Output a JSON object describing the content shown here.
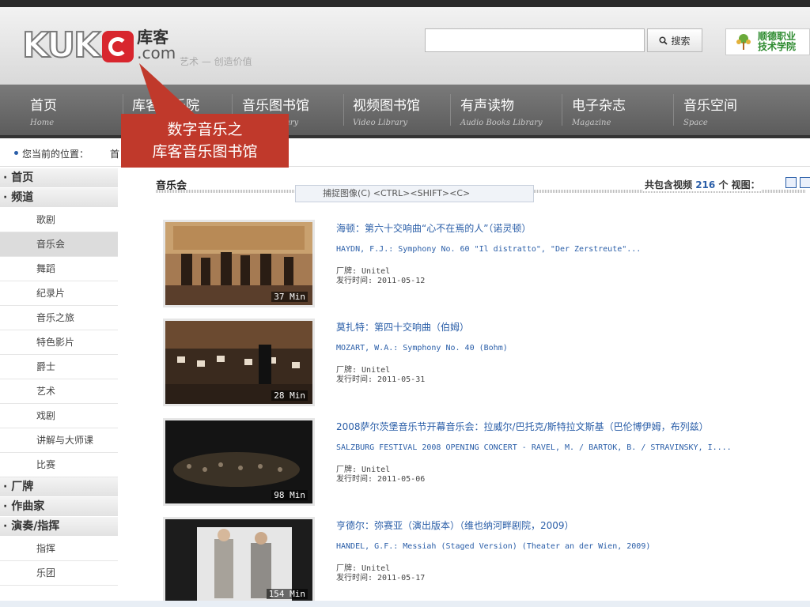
{
  "header": {
    "logo_main": "KUK",
    "logo_cn": "库客",
    "logo_com": ".com",
    "slogan": "艺术 — 创造价值",
    "search_placeholder": "",
    "search_button": "搜索",
    "school_line1": "顺德职业",
    "school_line2": "技术学院"
  },
  "nav": [
    {
      "cn": "首页",
      "en": "Home"
    },
    {
      "cn": "库客音乐院",
      "en": ""
    },
    {
      "cn": "音乐图书馆",
      "en": "Music Library"
    },
    {
      "cn": "视频图书馆",
      "en": "Video Library"
    },
    {
      "cn": "有声读物",
      "en": "Audio Books Library"
    },
    {
      "cn": "电子杂志",
      "en": "Magazine"
    },
    {
      "cn": "音乐空间",
      "en": "Space"
    }
  ],
  "breadcrumb": {
    "label": "您当前的位置：",
    "home": "首"
  },
  "callout": {
    "line1": "数字音乐之",
    "line2": "库客音乐图书馆"
  },
  "sidebar": {
    "home": "· 首页",
    "channel": "· 频道",
    "channel_items": [
      "歌剧",
      "音乐会",
      "舞蹈",
      "纪录片",
      "音乐之旅",
      "特色影片",
      "爵士",
      "艺术",
      "戏剧",
      "讲解与大师课",
      "比赛"
    ],
    "active_item": "音乐会",
    "label_heading": "· 厂牌",
    "composer_heading": "· 作曲家",
    "performer_heading": "· 演奏/指挥",
    "performer_items": [
      "指挥",
      "乐团"
    ]
  },
  "content": {
    "title": "音乐会",
    "capture_tip": "捕捉图像(C)   <CTRL><SHIFT><C>",
    "total_prefix": "共包含视频",
    "total_count": "216",
    "total_suffix": "个  视图：",
    "videos": [
      {
        "title": "海顿：第六十交响曲“心不在焉的人”（诺灵顿）",
        "subtitle": "HAYDN, F.J.: Symphony No. 60 \"Il distratto\", \"Der Zerstreute\"...",
        "label": "厂牌: Unitel",
        "date": "发行时间: 2011-05-12",
        "duration": "37 Min"
      },
      {
        "title": "莫扎特：第四十交响曲（伯姆）",
        "subtitle": "MOZART, W.A.: Symphony No. 40 (Bohm)",
        "label": "厂牌: Unitel",
        "date": "发行时间: 2011-05-31",
        "duration": "28 Min"
      },
      {
        "title": "2008萨尔茨堡音乐节开幕音乐会：拉威尔/巴托克/斯特拉文斯基（巴伦博伊姆，布列兹）",
        "subtitle": "SALZBURG FESTIVAL 2008 OPENING CONCERT - RAVEL, M. / BARTOK, B. / STRAVINSKY, I....",
        "label": "厂牌: Unitel",
        "date": "发行时间: 2011-05-06",
        "duration": "98 Min"
      },
      {
        "title": "亨德尔：弥赛亚（演出版本）（维也纳河畔剧院，2009）",
        "subtitle": "HANDEL, G.F.: Messiah (Staged Version) (Theater an der Wien, 2009)",
        "label": "厂牌: Unitel",
        "date": "发行时间: 2011-05-17",
        "duration": "154 Min"
      }
    ]
  },
  "colors": {
    "accent": "#2a5ea8",
    "callout": "#c0392b",
    "logo_red": "#d8262e"
  }
}
